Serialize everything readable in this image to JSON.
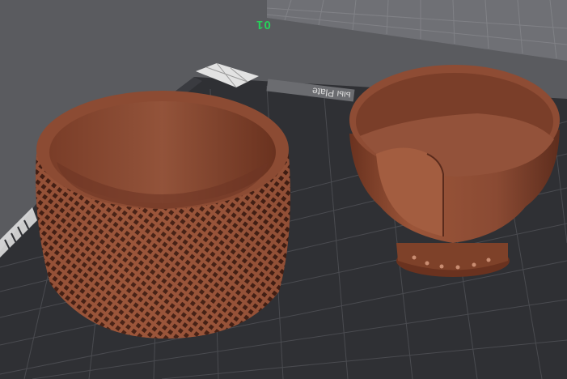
{
  "viewport": {
    "plate_number": "01",
    "plate_label": "ыы Plate",
    "colors": {
      "background": "#5a5b5f",
      "bed": "#2f3034",
      "grid": "#4a4b50",
      "filament": "#8a4a33",
      "plate_number": "#27d15a"
    }
  },
  "objects": [
    {
      "name": "lattice-basket"
    },
    {
      "name": "funnel-cup"
    }
  ]
}
